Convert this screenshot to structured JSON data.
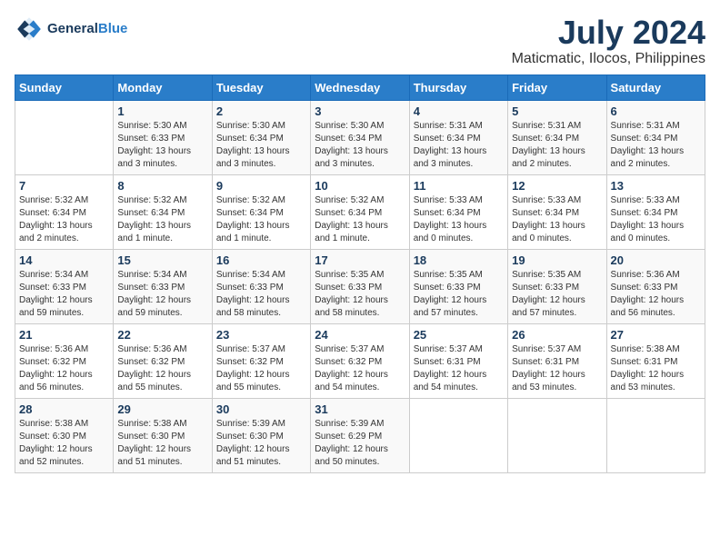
{
  "header": {
    "logo_line1": "General",
    "logo_line2": "Blue",
    "month": "July 2024",
    "location": "Maticmatic, Ilocos, Philippines"
  },
  "weekdays": [
    "Sunday",
    "Monday",
    "Tuesday",
    "Wednesday",
    "Thursday",
    "Friday",
    "Saturday"
  ],
  "weeks": [
    [
      {
        "day": "",
        "sunrise": "",
        "sunset": "",
        "daylight": ""
      },
      {
        "day": "1",
        "sunrise": "Sunrise: 5:30 AM",
        "sunset": "Sunset: 6:33 PM",
        "daylight": "Daylight: 13 hours and 3 minutes."
      },
      {
        "day": "2",
        "sunrise": "Sunrise: 5:30 AM",
        "sunset": "Sunset: 6:34 PM",
        "daylight": "Daylight: 13 hours and 3 minutes."
      },
      {
        "day": "3",
        "sunrise": "Sunrise: 5:30 AM",
        "sunset": "Sunset: 6:34 PM",
        "daylight": "Daylight: 13 hours and 3 minutes."
      },
      {
        "day": "4",
        "sunrise": "Sunrise: 5:31 AM",
        "sunset": "Sunset: 6:34 PM",
        "daylight": "Daylight: 13 hours and 3 minutes."
      },
      {
        "day": "5",
        "sunrise": "Sunrise: 5:31 AM",
        "sunset": "Sunset: 6:34 PM",
        "daylight": "Daylight: 13 hours and 2 minutes."
      },
      {
        "day": "6",
        "sunrise": "Sunrise: 5:31 AM",
        "sunset": "Sunset: 6:34 PM",
        "daylight": "Daylight: 13 hours and 2 minutes."
      }
    ],
    [
      {
        "day": "7",
        "sunrise": "Sunrise: 5:32 AM",
        "sunset": "Sunset: 6:34 PM",
        "daylight": "Daylight: 13 hours and 2 minutes."
      },
      {
        "day": "8",
        "sunrise": "Sunrise: 5:32 AM",
        "sunset": "Sunset: 6:34 PM",
        "daylight": "Daylight: 13 hours and 1 minute."
      },
      {
        "day": "9",
        "sunrise": "Sunrise: 5:32 AM",
        "sunset": "Sunset: 6:34 PM",
        "daylight": "Daylight: 13 hours and 1 minute."
      },
      {
        "day": "10",
        "sunrise": "Sunrise: 5:32 AM",
        "sunset": "Sunset: 6:34 PM",
        "daylight": "Daylight: 13 hours and 1 minute."
      },
      {
        "day": "11",
        "sunrise": "Sunrise: 5:33 AM",
        "sunset": "Sunset: 6:34 PM",
        "daylight": "Daylight: 13 hours and 0 minutes."
      },
      {
        "day": "12",
        "sunrise": "Sunrise: 5:33 AM",
        "sunset": "Sunset: 6:34 PM",
        "daylight": "Daylight: 13 hours and 0 minutes."
      },
      {
        "day": "13",
        "sunrise": "Sunrise: 5:33 AM",
        "sunset": "Sunset: 6:34 PM",
        "daylight": "Daylight: 13 hours and 0 minutes."
      }
    ],
    [
      {
        "day": "14",
        "sunrise": "Sunrise: 5:34 AM",
        "sunset": "Sunset: 6:33 PM",
        "daylight": "Daylight: 12 hours and 59 minutes."
      },
      {
        "day": "15",
        "sunrise": "Sunrise: 5:34 AM",
        "sunset": "Sunset: 6:33 PM",
        "daylight": "Daylight: 12 hours and 59 minutes."
      },
      {
        "day": "16",
        "sunrise": "Sunrise: 5:34 AM",
        "sunset": "Sunset: 6:33 PM",
        "daylight": "Daylight: 12 hours and 58 minutes."
      },
      {
        "day": "17",
        "sunrise": "Sunrise: 5:35 AM",
        "sunset": "Sunset: 6:33 PM",
        "daylight": "Daylight: 12 hours and 58 minutes."
      },
      {
        "day": "18",
        "sunrise": "Sunrise: 5:35 AM",
        "sunset": "Sunset: 6:33 PM",
        "daylight": "Daylight: 12 hours and 57 minutes."
      },
      {
        "day": "19",
        "sunrise": "Sunrise: 5:35 AM",
        "sunset": "Sunset: 6:33 PM",
        "daylight": "Daylight: 12 hours and 57 minutes."
      },
      {
        "day": "20",
        "sunrise": "Sunrise: 5:36 AM",
        "sunset": "Sunset: 6:33 PM",
        "daylight": "Daylight: 12 hours and 56 minutes."
      }
    ],
    [
      {
        "day": "21",
        "sunrise": "Sunrise: 5:36 AM",
        "sunset": "Sunset: 6:32 PM",
        "daylight": "Daylight: 12 hours and 56 minutes."
      },
      {
        "day": "22",
        "sunrise": "Sunrise: 5:36 AM",
        "sunset": "Sunset: 6:32 PM",
        "daylight": "Daylight: 12 hours and 55 minutes."
      },
      {
        "day": "23",
        "sunrise": "Sunrise: 5:37 AM",
        "sunset": "Sunset: 6:32 PM",
        "daylight": "Daylight: 12 hours and 55 minutes."
      },
      {
        "day": "24",
        "sunrise": "Sunrise: 5:37 AM",
        "sunset": "Sunset: 6:32 PM",
        "daylight": "Daylight: 12 hours and 54 minutes."
      },
      {
        "day": "25",
        "sunrise": "Sunrise: 5:37 AM",
        "sunset": "Sunset: 6:31 PM",
        "daylight": "Daylight: 12 hours and 54 minutes."
      },
      {
        "day": "26",
        "sunrise": "Sunrise: 5:37 AM",
        "sunset": "Sunset: 6:31 PM",
        "daylight": "Daylight: 12 hours and 53 minutes."
      },
      {
        "day": "27",
        "sunrise": "Sunrise: 5:38 AM",
        "sunset": "Sunset: 6:31 PM",
        "daylight": "Daylight: 12 hours and 53 minutes."
      }
    ],
    [
      {
        "day": "28",
        "sunrise": "Sunrise: 5:38 AM",
        "sunset": "Sunset: 6:30 PM",
        "daylight": "Daylight: 12 hours and 52 minutes."
      },
      {
        "day": "29",
        "sunrise": "Sunrise: 5:38 AM",
        "sunset": "Sunset: 6:30 PM",
        "daylight": "Daylight: 12 hours and 51 minutes."
      },
      {
        "day": "30",
        "sunrise": "Sunrise: 5:39 AM",
        "sunset": "Sunset: 6:30 PM",
        "daylight": "Daylight: 12 hours and 51 minutes."
      },
      {
        "day": "31",
        "sunrise": "Sunrise: 5:39 AM",
        "sunset": "Sunset: 6:29 PM",
        "daylight": "Daylight: 12 hours and 50 minutes."
      },
      {
        "day": "",
        "sunrise": "",
        "sunset": "",
        "daylight": ""
      },
      {
        "day": "",
        "sunrise": "",
        "sunset": "",
        "daylight": ""
      },
      {
        "day": "",
        "sunrise": "",
        "sunset": "",
        "daylight": ""
      }
    ]
  ]
}
